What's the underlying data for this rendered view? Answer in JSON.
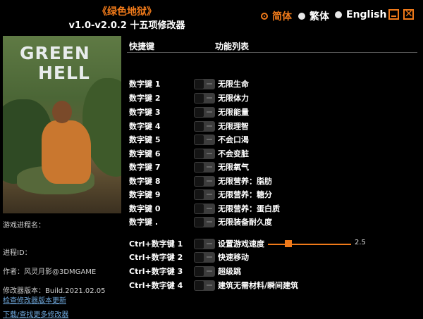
{
  "title": {
    "game": "《绿色地狱》",
    "version": "v1.0-v2.0.2 十五项修改器"
  },
  "languages": [
    {
      "label": "简体",
      "active": true
    },
    {
      "label": "繁体",
      "active": false
    },
    {
      "label": "English",
      "active": false
    }
  ],
  "cover": {
    "logo_line1": "GREEN",
    "logo_line2": "HELL"
  },
  "info": {
    "process_label": "游戏进程名：",
    "pid_label": "进程ID：",
    "author": "作者：风灵月影@3DMGAME",
    "trainer_version": "修改器版本：Build.2021.02.05",
    "check_update": "检查修改器版本更新",
    "download_more": "下载/查找更多修改器"
  },
  "headers": {
    "hotkey": "快捷键",
    "function": "功能列表"
  },
  "cheats": [
    {
      "key": "数字键 1",
      "label": "无限生命"
    },
    {
      "key": "数字键 2",
      "label": "无限体力"
    },
    {
      "key": "数字键 3",
      "label": "无限能量"
    },
    {
      "key": "数字键 4",
      "label": "无限理智"
    },
    {
      "key": "数字键 5",
      "label": "不会口渴"
    },
    {
      "key": "数字键 6",
      "label": "不会变脏"
    },
    {
      "key": "数字键 7",
      "label": "无限氧气"
    },
    {
      "key": "数字键 8",
      "label": "无限营养：脂肪"
    },
    {
      "key": "数字键 9",
      "label": "无限营养：糖分"
    },
    {
      "key": "数字键 0",
      "label": "无限营养：蛋白质"
    },
    {
      "key": "数字键 .",
      "label": "无限装备耐久度"
    },
    {
      "key": "Ctrl+数字键 1",
      "label": "设置游戏速度"
    },
    {
      "key": "Ctrl+数字键 2",
      "label": "快速移动"
    },
    {
      "key": "Ctrl+数字键 3",
      "label": "超级跳"
    },
    {
      "key": "Ctrl+数字键 4",
      "label": "建筑无需材料/瞬间建筑"
    }
  ],
  "speed_slider": {
    "value": "2.5",
    "fraction": 0.22
  },
  "colors": {
    "accent": "#f07a1a",
    "background": "#000000",
    "link": "#6fa8dc"
  }
}
